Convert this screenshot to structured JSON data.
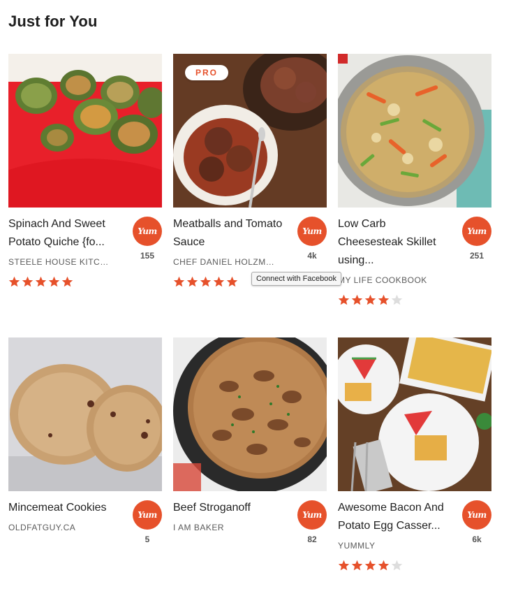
{
  "section": {
    "title": "Just for You"
  },
  "tooltip": {
    "text": "Connect with Facebook"
  },
  "colors": {
    "brand": "#e6512b",
    "star_filled": "#e6512b",
    "star_empty": "#dddddd"
  },
  "cards": [
    {
      "title": "Spinach And Sweet Potato Quiche {fo...",
      "source": "STEELE HOUSE KITCH...",
      "yum_label": "Yum",
      "yum_count": "155",
      "rating": 5,
      "pro": false,
      "image_icon": "quiche-photo"
    },
    {
      "title": "Meatballs and Tomato Sauce",
      "source": "CHEF DANIEL HOLZMAN",
      "yum_label": "Yum",
      "yum_count": "4k",
      "rating": 5,
      "pro": true,
      "pro_label": "PRO",
      "image_icon": "meatballs-photo"
    },
    {
      "title": "Low Carb Cheesesteak Skillet using...",
      "source": "MY LIFE COOKBOOK",
      "yum_label": "Yum",
      "yum_count": "251",
      "rating": 4,
      "pro": false,
      "image_icon": "skillet-photo"
    },
    {
      "title": "Mincemeat Cookies",
      "source": "OLDFATGUY.CA",
      "yum_label": "Yum",
      "yum_count": "5",
      "rating": 0,
      "pro": false,
      "image_icon": "cookies-photo"
    },
    {
      "title": "Beef Stroganoff",
      "source": "I AM BAKER",
      "yum_label": "Yum",
      "yum_count": "82",
      "rating": 0,
      "pro": false,
      "image_icon": "stroganoff-photo"
    },
    {
      "title": "Awesome Bacon And Potato Egg Casser...",
      "source": "YUMMLY",
      "yum_label": "Yum",
      "yum_count": "6k",
      "rating": 4,
      "pro": false,
      "image_icon": "casserole-photo"
    }
  ]
}
